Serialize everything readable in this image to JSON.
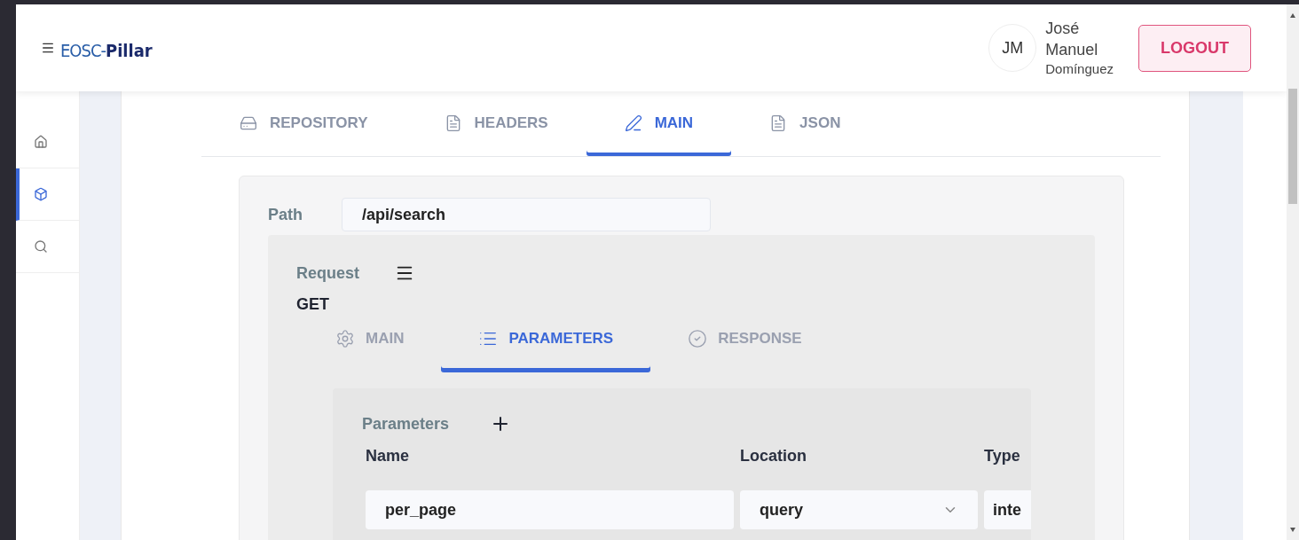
{
  "header": {
    "logo": {
      "prefix": "EOSC-",
      "suffix": "Pillar"
    },
    "user": {
      "initials": "JM",
      "first_name": "José",
      "middle_name": "Manuel",
      "last_name": "Domínguez"
    },
    "logout": "LOGOUT"
  },
  "sidebar": {
    "items": [
      {
        "selected": false
      },
      {
        "selected": true
      },
      {
        "selected": false
      }
    ]
  },
  "tabs": [
    {
      "label": "REPOSITORY",
      "selected": false
    },
    {
      "label": "HEADERS",
      "selected": false
    },
    {
      "label": "MAIN",
      "selected": true
    },
    {
      "label": "JSON",
      "selected": false
    }
  ],
  "path": {
    "label": "Path",
    "value": "/api/search"
  },
  "request": {
    "label": "Request",
    "method": "GET",
    "tabs": [
      {
        "label": "MAIN",
        "selected": false
      },
      {
        "label": "PARAMETERS",
        "selected": true
      },
      {
        "label": "RESPONSE",
        "selected": false
      }
    ],
    "parameters": {
      "label": "Parameters",
      "columns": [
        "Name",
        "Location",
        "Type"
      ],
      "rows": [
        {
          "name": "per_page",
          "location": "query",
          "type": "inte"
        }
      ]
    }
  }
}
